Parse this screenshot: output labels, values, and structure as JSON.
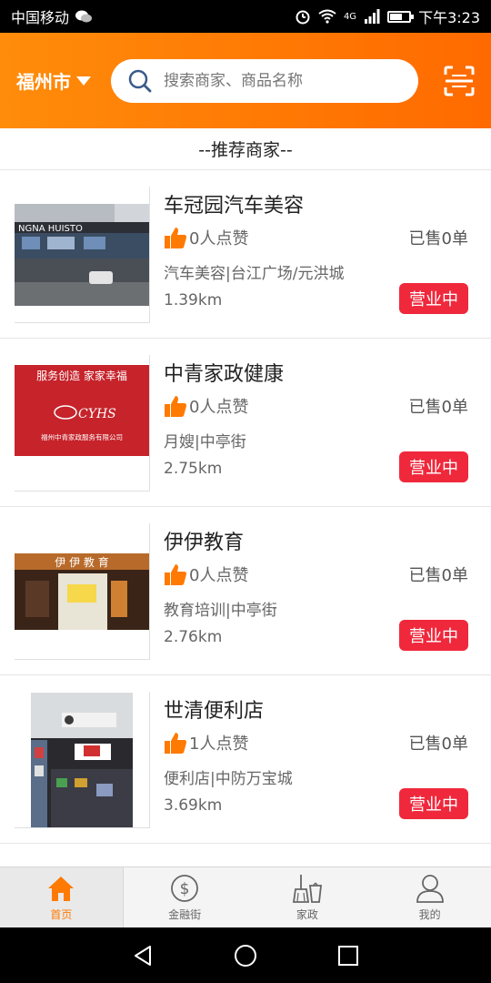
{
  "status_bar": {
    "carrier": "中国移动",
    "network": "4G",
    "time": "下午3:23"
  },
  "header": {
    "city": "福州市",
    "search_placeholder": "搜索商家、商品名称"
  },
  "section_title": "--推荐商家--",
  "merchants": [
    {
      "name": "车冠园汽车美容",
      "likes": "0人点赞",
      "sold": "已售0单",
      "category": "汽车美容|台江广场/元洪城",
      "distance": "1.39km",
      "status": "营业中",
      "photo_text": "NGNA HUISTO"
    },
    {
      "name": "中青家政健康",
      "likes": "0人点赞",
      "sold": "已售0单",
      "category": "月嫂|中亭街",
      "distance": "2.75km",
      "status": "营业中",
      "photo_text": "服务创造 家家幸福",
      "photo_sub": "福州中青家政服务有限公司"
    },
    {
      "name": "伊伊教育",
      "likes": "0人点赞",
      "sold": "已售0单",
      "category": "教育培训|中亭街",
      "distance": "2.76km",
      "status": "营业中",
      "photo_text": "伊 伊 教 育"
    },
    {
      "name": "世清便利店",
      "likes": "1人点赞",
      "sold": "已售0单",
      "category": "便利店|中防万宝城",
      "distance": "3.69km",
      "status": "营业中"
    }
  ],
  "tabs": [
    {
      "label": "首页",
      "icon": "home-icon"
    },
    {
      "label": "金融街",
      "icon": "dollar-icon"
    },
    {
      "label": "家政",
      "icon": "broom-icon"
    },
    {
      "label": "我的",
      "icon": "user-icon"
    }
  ],
  "colors": {
    "header_start": "#ff8c0a",
    "header_end": "#ff6a00",
    "open_badge": "#f0283c",
    "thumb_icon": "#ff7a00",
    "tab_active": "#ff7a00"
  }
}
